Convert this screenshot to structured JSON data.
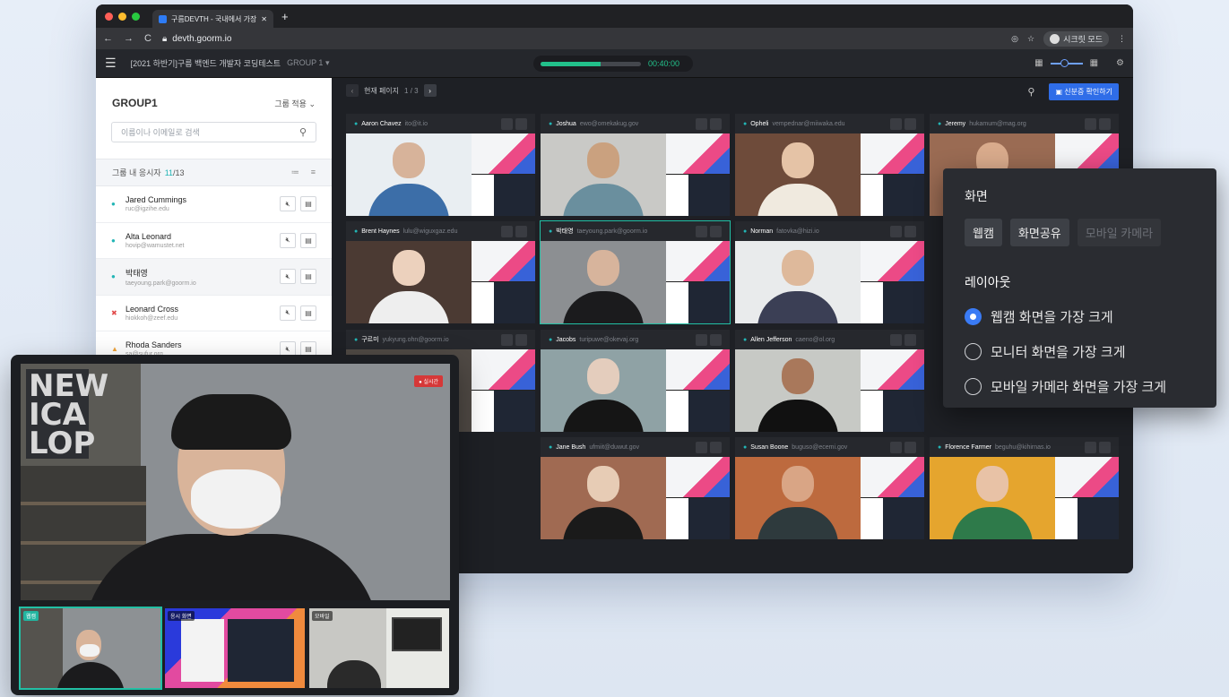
{
  "browser": {
    "tab_title": "구름DEVTH - 국내에서 가장 많이 ·",
    "url": "devth.goorm.io",
    "incognito_label": "시크릿 모드"
  },
  "header": {
    "title": "[2021 하반기]구름 백엔드 개발자 코딩테스트",
    "group": "GROUP 1",
    "timer": "00:40:00",
    "timer_progress": 0.6
  },
  "sidebar": {
    "title": "GROUP1",
    "apply_label": "그룹 적용",
    "search_placeholder": "이름이나 이메일로 검색",
    "count_label": "그룹 내 응시자",
    "count_current": "11",
    "count_total": "/13",
    "candidates": [
      {
        "name": "Jared Cummings",
        "email": "ruc@igzihe.edu",
        "status": "online"
      },
      {
        "name": "Alta Leonard",
        "email": "hovip@wamustet.net",
        "status": "online"
      },
      {
        "name": "박태영",
        "email": "taeyoung.park@goorm.io",
        "status": "online"
      },
      {
        "name": "Leonard Cross",
        "email": "hiokkoh@zeef.edu",
        "status": "error"
      },
      {
        "name": "Rhoda Sanders",
        "email": "sa@sufur.org",
        "status": "warning"
      }
    ]
  },
  "main": {
    "page_label": "현재 페이지",
    "page_num": "1 / 3",
    "id_button": "신분증 확인하기",
    "cells": [
      {
        "name": "Aaron Chavez",
        "email": "ito@it.io"
      },
      {
        "name": "Joshua",
        "email": "ewo@omekakug.gov"
      },
      {
        "name": "Opheli",
        "email": "vempednar@miiwaka.edu"
      },
      {
        "name": "Jeremy",
        "email": "hukamum@mag.org"
      },
      {
        "name": "Brent Haynes",
        "email": "lulu@wiguxgaz.edu"
      },
      {
        "name": "박태영",
        "email": "taeyoung.park@goorm.io"
      },
      {
        "name": "Norman",
        "email": "fatovka@hizi.io"
      },
      {
        "name": "",
        "email": ""
      },
      {
        "name": "구르미",
        "email": "yukyung.ohn@goorm.io"
      },
      {
        "name": "Jacobs",
        "email": "turipuwe@okevaj.org"
      },
      {
        "name": "Allen Jefferson",
        "email": "caeno@ol.org"
      },
      {
        "name": "",
        "email": ""
      },
      {
        "name": "",
        "email": ""
      },
      {
        "name": "Jane Bush",
        "email": "ufmiit@duwut.gov"
      },
      {
        "name": "Susan Boone",
        "email": "buguso@ecemi.gov"
      },
      {
        "name": "Florence Farmer",
        "email": "beguhu@kihirnas.io"
      }
    ]
  },
  "popup": {
    "screen_title": "화면",
    "chips": [
      "웹캠",
      "화면공유",
      "모바일 카메라"
    ],
    "layout_title": "레이아웃",
    "options": [
      "웹캠 화면을 가장 크게",
      "모니터 화면을 가장 크게",
      "모바일 카메라 화면을 가장 크게"
    ]
  },
  "overlay": {
    "live_label": "실시간",
    "thumb_labels": [
      "웹캠",
      "응시 화면",
      "모바일"
    ],
    "sign_text": "NEW\nICA\nLOP"
  }
}
